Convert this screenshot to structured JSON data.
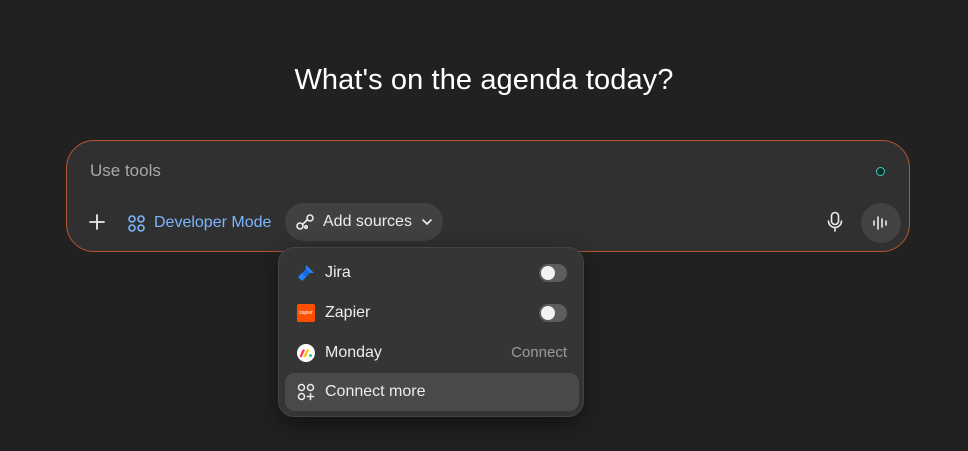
{
  "headline": "What's on the agenda today?",
  "composer": {
    "placeholder": "Use tools",
    "developer_mode_label": "Developer Mode",
    "add_sources_label": "Add sources"
  },
  "dropdown": {
    "items": [
      {
        "label": "Jira",
        "icon": "jira-logo-icon",
        "control": "toggle",
        "enabled": false
      },
      {
        "label": "Zapier",
        "icon": "zapier-logo-icon",
        "control": "toggle",
        "enabled": false,
        "logo_text": "zapier"
      },
      {
        "label": "Monday",
        "icon": "monday-logo-icon",
        "control": "link",
        "action_label": "Connect"
      },
      {
        "label": "Connect more",
        "icon": "connect-more-icon",
        "control": "none"
      }
    ]
  },
  "colors": {
    "background": "#212121",
    "composer_bg": "#303030",
    "composer_border": "#b4572e",
    "accent_blue": "#7cb6ff",
    "status_dot": "#3ccfae",
    "zapier_orange": "#ff4f00",
    "jira_blue": "#2684ff"
  }
}
